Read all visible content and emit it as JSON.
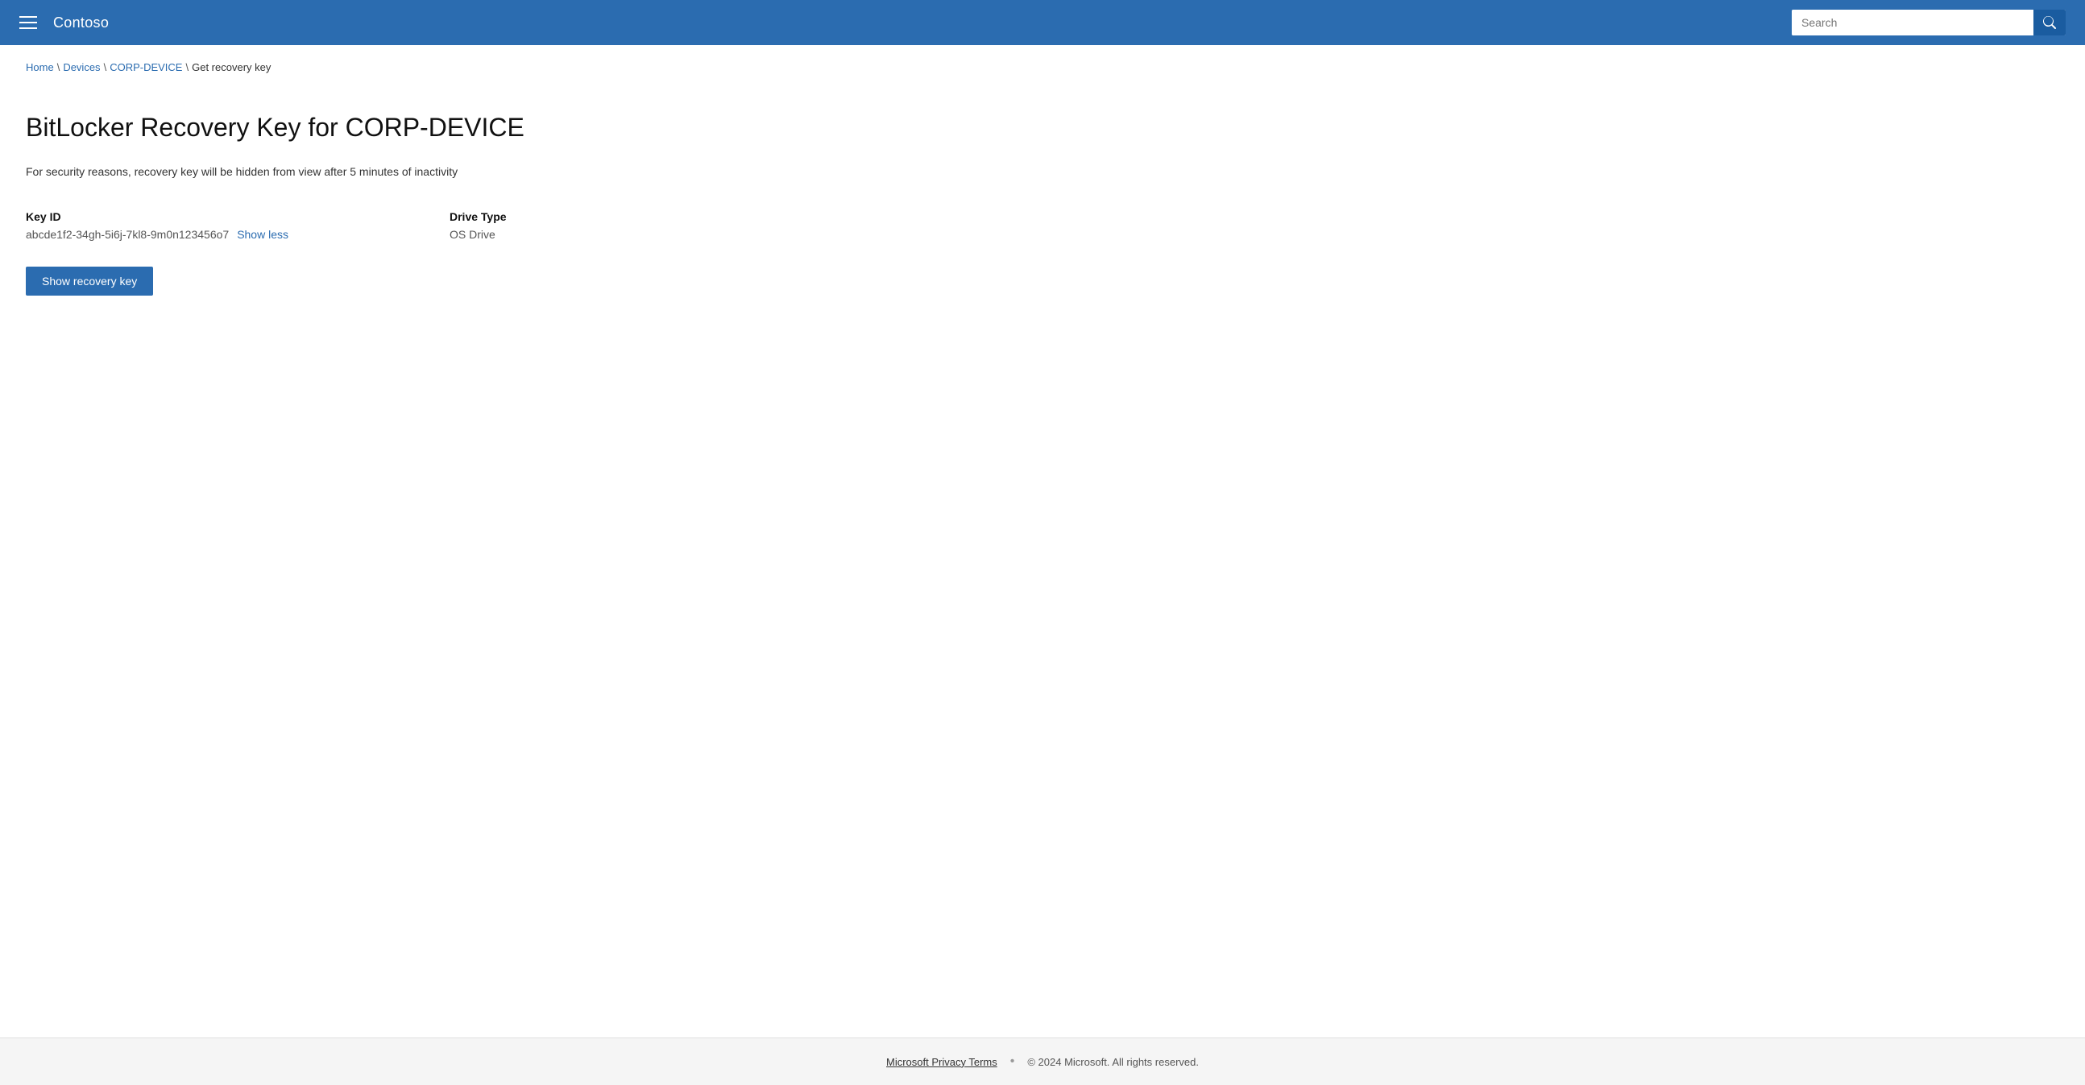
{
  "header": {
    "app_title": "Contoso",
    "search_placeholder": "Search"
  },
  "breadcrumb": {
    "home_label": "Home",
    "devices_label": "Devices",
    "device_label": "CORP-DEVICE",
    "current_label": "Get recovery key",
    "separator": "\\"
  },
  "main": {
    "page_title": "BitLocker Recovery Key for CORP-DEVICE",
    "security_notice": "For security reasons, recovery key will be hidden from view after 5 minutes of inactivity",
    "key_id_label": "Key ID",
    "key_id_value": "abcde1f2-34gh-5i6j-7kl8-9m0n123456o7",
    "show_less_label": "Show less",
    "drive_type_label": "Drive Type",
    "drive_type_value": "OS Drive",
    "show_recovery_key_btn": "Show recovery key"
  },
  "footer": {
    "privacy_link": "Microsoft Privacy Terms",
    "copyright": "© 2024 Microsoft. All rights reserved."
  }
}
